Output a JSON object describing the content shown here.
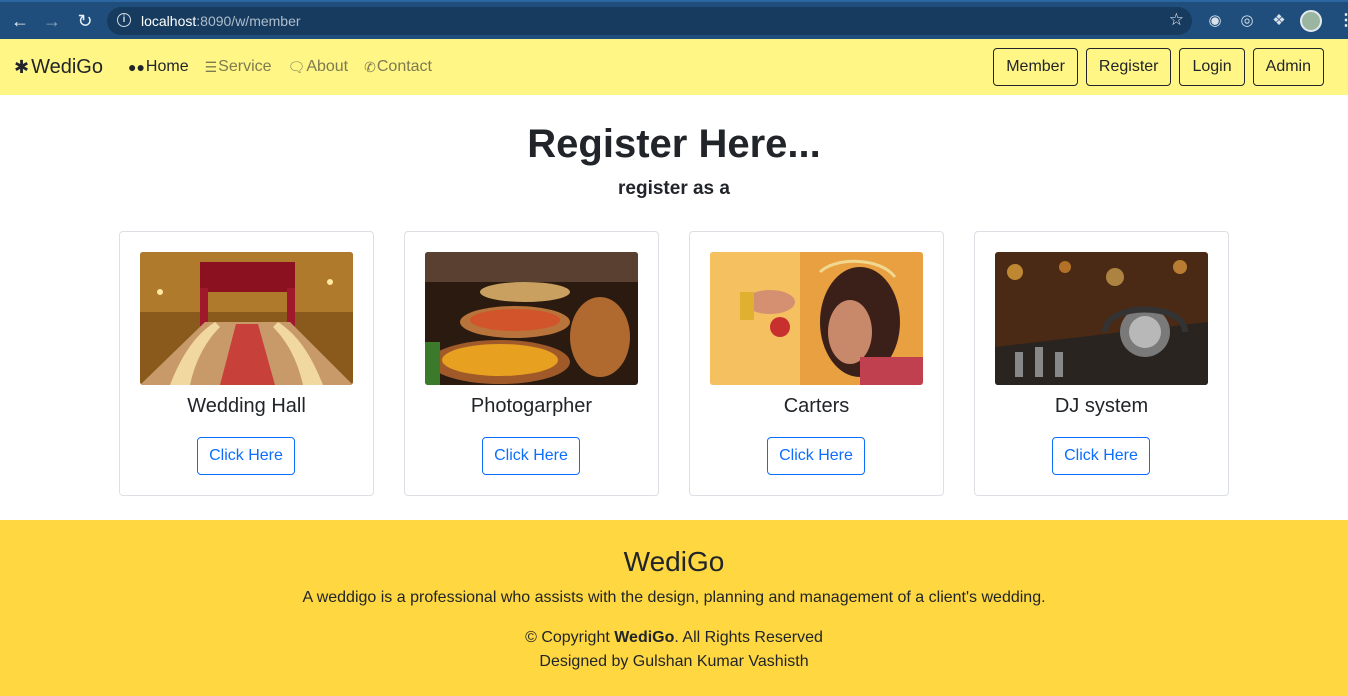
{
  "browser": {
    "url_host": "localhost",
    "url_rest": ":8090/w/member"
  },
  "navbar": {
    "brand": "WediGo",
    "links": [
      {
        "label": "Home",
        "icon": "users-icon"
      },
      {
        "label": "Service",
        "icon": "list-icon"
      },
      {
        "label": "About",
        "icon": "chat-icon"
      },
      {
        "label": "Contact",
        "icon": "phone-icon"
      }
    ],
    "buttons": [
      "Member",
      "Register",
      "Login",
      "Admin"
    ]
  },
  "main": {
    "title": "Register Here...",
    "subtitle": "register as a",
    "cards": [
      {
        "name": "Wedding Hall",
        "button": "Click Here"
      },
      {
        "name": "Photogarpher",
        "button": "Click Here"
      },
      {
        "name": "Carters",
        "button": "Click Here"
      },
      {
        "name": "DJ system",
        "button": "Click Here"
      }
    ]
  },
  "footer": {
    "brand": "WediGo",
    "description": "A weddigo is a professional who assists with the design, planning and management of a client's wedding.",
    "copyright_prefix": "© Copyright ",
    "copyright_brand": "WediGo",
    "copyright_suffix": ". All Rights Reserved",
    "designed_by": "Designed by Gulshan Kumar Vashisth"
  },
  "colors": {
    "navbar_bg": "#fff685",
    "footer_bg": "#ffd740",
    "primary": "#0d6efd",
    "chrome_bg": "#1f4e7d"
  }
}
